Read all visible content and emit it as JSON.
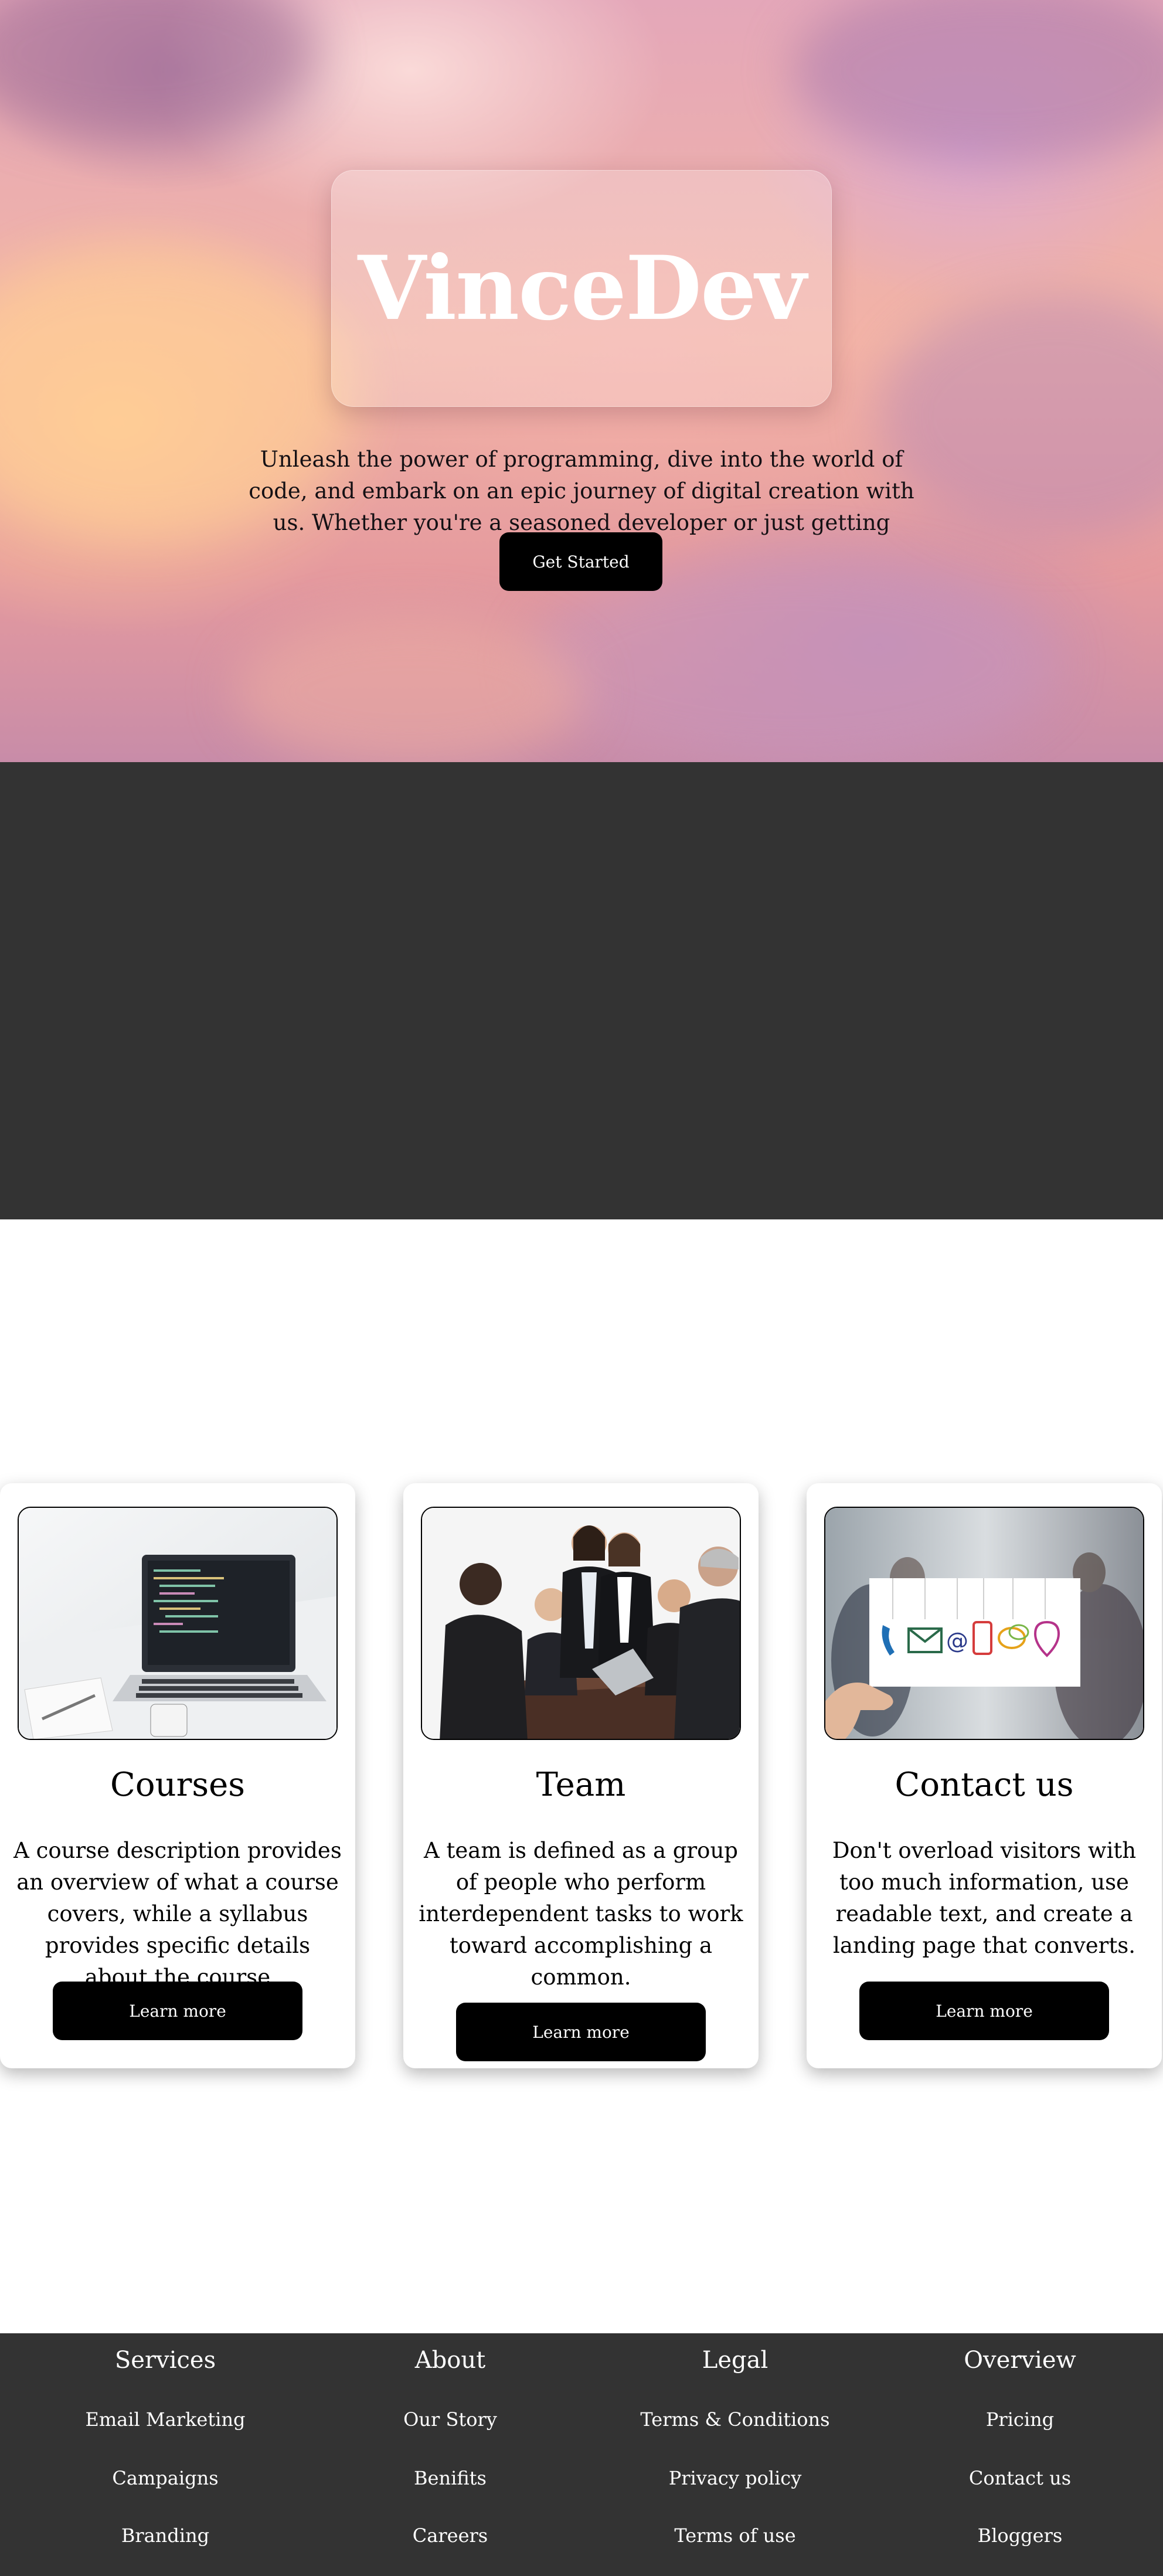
{
  "hero": {
    "logo": "VinceDev",
    "description": "Unleash the power of programming, dive into the world of code, and embark on an epic journey of digital creation with us. Whether you're a seasoned developer or just getting started.",
    "button_label": "Get Started"
  },
  "cards": [
    {
      "title": "Courses",
      "description": "A course description provides an overview of what a course covers, while a syllabus provides specific details about the course",
      "button_label": "Learn more"
    },
    {
      "title": "Team",
      "description": "A team is defined as a group of people who perform interdependent tasks to work toward accomplishing a common.",
      "button_label": "Learn more"
    },
    {
      "title": "Contact us",
      "description": "Don't overload visitors with too much information, use readable text, and create a landing page that converts.",
      "button_label": "Learn more"
    }
  ],
  "footer": {
    "columns": [
      {
        "heading": "Services",
        "links": [
          "Email Marketing",
          "Campaigns",
          "Branding"
        ]
      },
      {
        "heading": "About",
        "links": [
          "Our Story",
          "Benifits",
          "Careers"
        ]
      },
      {
        "heading": "Legal",
        "links": [
          "Terms & Conditions",
          "Privacy policy",
          "Terms of use"
        ]
      },
      {
        "heading": "Overview",
        "links": [
          "Pricing",
          "Contact us",
          "Bloggers"
        ]
      }
    ]
  },
  "colors": {
    "dark_band": "#333333",
    "button": "#000000",
    "footer": "#333333"
  }
}
